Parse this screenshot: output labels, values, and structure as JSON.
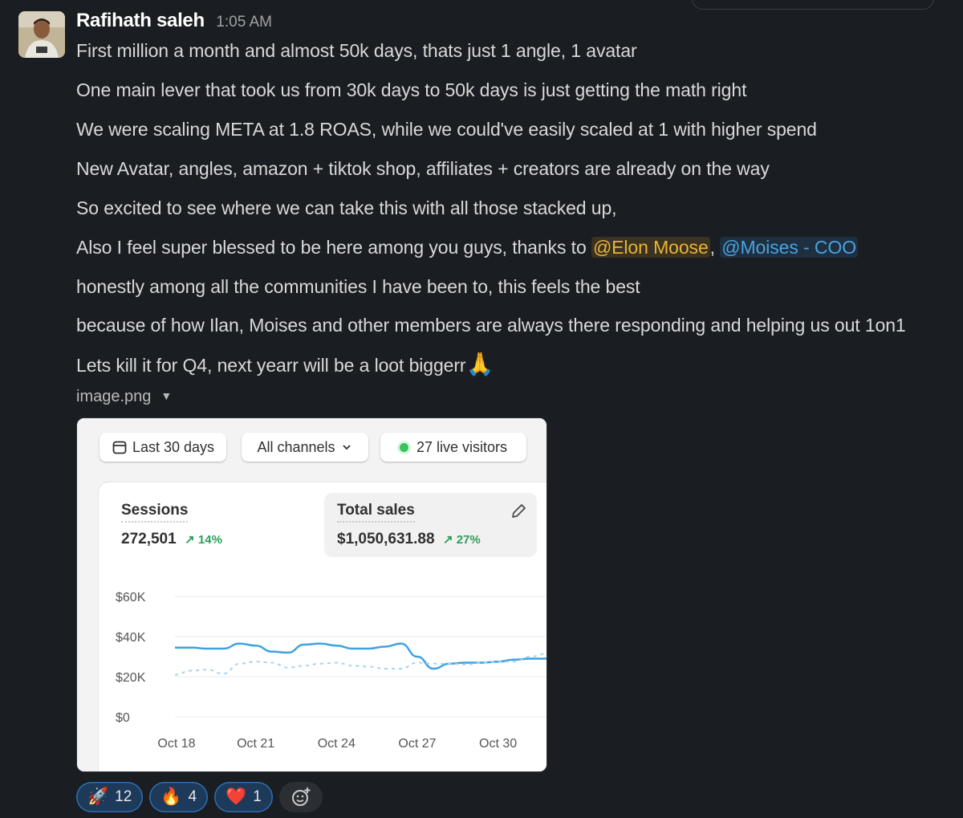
{
  "message": {
    "author": "Rafihath saleh",
    "time": "1:05 AM",
    "lines": [
      "First million a month and almost 50k days, thats just 1 angle, 1 avatar",
      "One main lever that took us from 30k days to 50k days is just getting the math right",
      "We were scaling META at 1.8 ROAS, while we could've easily scaled at 1 with higher spend",
      "New Avatar, angles, amazon + tiktok shop, affiliates + creators are already on the way",
      "So excited to see where we can take this with all those stacked up,"
    ],
    "thanks_prefix": "Also I feel super blessed to be here among you guys, thanks to ",
    "mention1": "@Elon Moose",
    "separator": ", ",
    "mention2": "@Moises - COO",
    "line7": "honestly among all the communities I have been to, this feels the best",
    "line8": "because of how Ilan, Moises and other members are always there responding and helping us out 1on1",
    "line9": "Lets kill it for Q4, next yearr will be a loot biggerr",
    "line9_emoji": "🙏",
    "file_name": "image.png"
  },
  "dashboard": {
    "date_chip": "Last 30 days",
    "channels_chip": "All channels",
    "live_chip": "27 live visitors",
    "sessions": {
      "label": "Sessions",
      "value": "272,501",
      "delta": "14%"
    },
    "sales": {
      "label": "Total sales",
      "value": "$1,050,631.88",
      "delta": "27%"
    }
  },
  "chart_data": {
    "type": "line",
    "y_ticks": [
      "$60K",
      "$40K",
      "$20K",
      "$0"
    ],
    "ylim": [
      0,
      60000
    ],
    "x_ticks": [
      "Oct 18",
      "Oct 21",
      "Oct 24",
      "Oct 27",
      "Oct 30"
    ],
    "series": [
      {
        "style": "solid",
        "color": "#3fa2e0",
        "x": [
          0,
          0.6,
          1.2,
          1.8,
          2.4,
          3,
          3.6,
          4.2,
          4.8,
          5.4,
          6,
          6.6,
          7.2,
          7.8,
          8.4,
          9,
          9.6,
          10.2,
          10.8,
          11.4,
          12,
          12.6,
          13.2,
          13.8
        ],
        "y": [
          34500,
          34500,
          34000,
          34000,
          36500,
          35500,
          32500,
          32000,
          36000,
          36500,
          35500,
          34000,
          34000,
          35000,
          36500,
          30000,
          24000,
          26500,
          27000,
          27000,
          27500,
          28500,
          29000,
          29000
        ]
      },
      {
        "style": "dashed",
        "color": "#a8d3f0",
        "x": [
          0,
          0.6,
          1.2,
          1.8,
          2.4,
          3,
          3.6,
          4.2,
          4.8,
          5.4,
          6,
          6.6,
          7.2,
          7.8,
          8.4,
          9,
          9.6,
          10.2,
          10.8,
          11.4,
          12,
          12.6,
          13.2,
          13.8
        ],
        "y": [
          21000,
          23000,
          23500,
          21500,
          26500,
          27500,
          27000,
          24500,
          25500,
          26500,
          27000,
          25500,
          25000,
          24000,
          24000,
          27000,
          26500,
          26500,
          26000,
          27000,
          27500,
          27500,
          30000,
          31500
        ]
      }
    ]
  },
  "reactions": [
    {
      "emoji": "🚀",
      "count": "12"
    },
    {
      "emoji": "🔥",
      "count": "4"
    },
    {
      "emoji": "❤️",
      "count": "1"
    }
  ]
}
